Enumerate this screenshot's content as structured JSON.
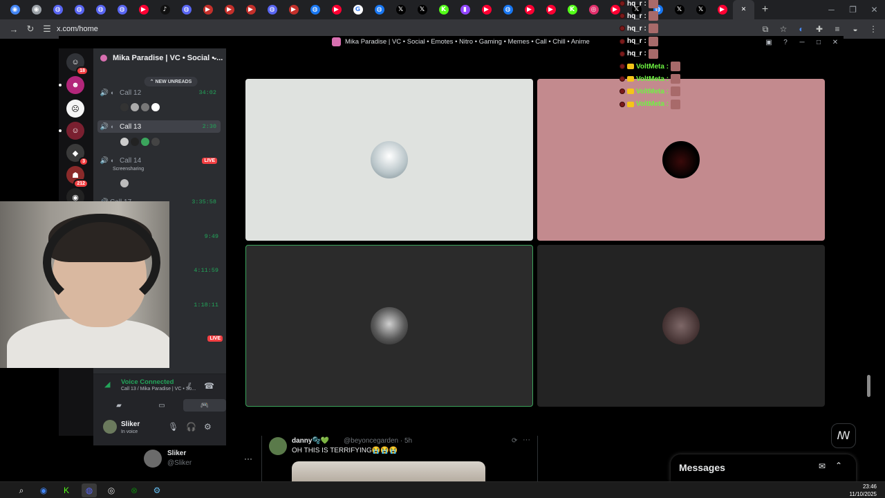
{
  "browser": {
    "url": "x.com/home",
    "tabs": [
      {
        "icon": "chrome-icon",
        "color": "#4285f4",
        "glyph": "◉"
      },
      {
        "icon": "chrome-icon",
        "color": "#9aa0a6",
        "glyph": "◉"
      },
      {
        "icon": "discord-icon",
        "color": "#5865f2",
        "glyph": "◍"
      },
      {
        "icon": "discord-icon",
        "color": "#5865f2",
        "glyph": "◍"
      },
      {
        "icon": "discord-icon",
        "color": "#5865f2",
        "glyph": "◍"
      },
      {
        "icon": "discord-icon",
        "color": "#5865f2",
        "glyph": "◍"
      },
      {
        "icon": "youtube-icon",
        "color": "#ff0033",
        "glyph": "▶"
      },
      {
        "icon": "tiktok-icon",
        "color": "#111111",
        "glyph": "♪"
      },
      {
        "icon": "discord-icon",
        "color": "#5865f2",
        "glyph": "◍"
      },
      {
        "icon": "youtube-icon",
        "color": "#c4302b",
        "glyph": "▶"
      },
      {
        "icon": "youtube-icon",
        "color": "#c4302b",
        "glyph": "▶"
      },
      {
        "icon": "youtube-icon",
        "color": "#c4302b",
        "glyph": "▶"
      },
      {
        "icon": "discord-icon",
        "color": "#5865f2",
        "glyph": "◍"
      },
      {
        "icon": "youtube-icon",
        "color": "#c4302b",
        "glyph": "▶"
      },
      {
        "icon": "messenger-icon",
        "color": "#1877f2",
        "glyph": "◍"
      },
      {
        "icon": "youtube-icon",
        "color": "#ff0033",
        "glyph": "▶"
      },
      {
        "icon": "google-icon",
        "color": "#ffffff",
        "glyph": "G"
      },
      {
        "icon": "messenger-icon",
        "color": "#1877f2",
        "glyph": "◍"
      },
      {
        "icon": "x-icon",
        "color": "#000000",
        "glyph": "𝕏"
      },
      {
        "icon": "x-icon",
        "color": "#000000",
        "glyph": "𝕏"
      },
      {
        "icon": "kick-icon",
        "color": "#53fc18",
        "glyph": "K"
      },
      {
        "icon": "twitch-icon",
        "color": "#9146ff",
        "glyph": "▮"
      },
      {
        "icon": "youtube-icon",
        "color": "#ff0033",
        "glyph": "▶"
      },
      {
        "icon": "messenger-icon",
        "color": "#1877f2",
        "glyph": "◍"
      },
      {
        "icon": "youtube-icon",
        "color": "#ff0033",
        "glyph": "▶"
      },
      {
        "icon": "youtube-icon",
        "color": "#ff0033",
        "glyph": "▶"
      },
      {
        "icon": "kick-icon",
        "color": "#53fc18",
        "glyph": "K"
      },
      {
        "icon": "instagram-icon",
        "color": "#e1306c",
        "glyph": "◎"
      },
      {
        "icon": "youtube-icon",
        "color": "#ff0033",
        "glyph": "▶"
      },
      {
        "icon": "x-icon",
        "color": "#000000",
        "glyph": "𝕏"
      },
      {
        "icon": "messenger-icon",
        "color": "#1877f2",
        "glyph": "◍"
      },
      {
        "icon": "x-icon",
        "color": "#000000",
        "glyph": "𝕏"
      },
      {
        "icon": "x-icon",
        "color": "#000000",
        "glyph": "𝕏"
      },
      {
        "icon": "youtube-icon",
        "color": "#ff0033",
        "glyph": "▶"
      },
      {
        "icon": "x-icon",
        "color": "#000000",
        "glyph": "✕",
        "active": true
      }
    ]
  },
  "discord": {
    "title": "Mika Paradise | VC • Social • Emotes • Nitro • Gaming • Memes • Call • Chill • Anime",
    "server_name": "Mika Paradise | VC • Social • ...",
    "new_unreads": "NEW UNREADS",
    "server_badges": [
      "18",
      "3",
      "212"
    ],
    "channels": [
      {
        "name": "Call 12",
        "time": "34:02",
        "selected": false
      },
      {
        "name": "Call 13",
        "time": "2:30",
        "selected": true
      },
      {
        "name": "Call 14",
        "live": "LIVE",
        "sub": "Screensharing",
        "selected": false
      },
      {
        "name": "Call 17",
        "time": "3:35:58",
        "selected": false
      }
    ],
    "extra_timers": [
      "9:49",
      "4:11:59",
      "1:18:11"
    ],
    "extra_live": "LIVE",
    "voice_status": "Voice Connected",
    "voice_channel": "Call 13 / Mika Paradise | VC • So...",
    "user_name": "Sliker",
    "user_status": "In voice",
    "tiles": [
      {
        "bg": "#dfe2df",
        "border": "none"
      },
      {
        "bg": "#c38a8e",
        "border": "none"
      },
      {
        "bg": "#2b2b2b",
        "border": "#3ba55c"
      },
      {
        "bg": "#232323",
        "border": "none"
      }
    ]
  },
  "chat_overlay": [
    {
      "user": "hq_r :",
      "color": "#ffffff"
    },
    {
      "user": "hq_r :",
      "color": "#ffffff"
    },
    {
      "user": "hq_r :",
      "color": "#ffffff"
    },
    {
      "user": "hq_r :",
      "color": "#ffffff"
    },
    {
      "user": "hq_r :",
      "color": "#ffffff"
    },
    {
      "user": "VoltMeta :",
      "color": "#6ef542"
    },
    {
      "user": "VoltMeta :",
      "color": "#6ef542"
    },
    {
      "user": "VoltMeta :",
      "color": "#6ef542"
    },
    {
      "user": "VoltMeta :",
      "color": "#6ef542"
    }
  ],
  "x_page": {
    "profile_name": "Sliker",
    "profile_handle": "@Sliker",
    "more": "···",
    "tweet": {
      "author": "danny🫧💚",
      "handle_time": "@beyoncegarden · 5h",
      "text": "OH THIS IS TERRIFYING😭😭😭",
      "more": "···"
    },
    "messages_title": "Messages"
  },
  "taskbar": {
    "time": "23:46",
    "date": "11/10/2025"
  }
}
